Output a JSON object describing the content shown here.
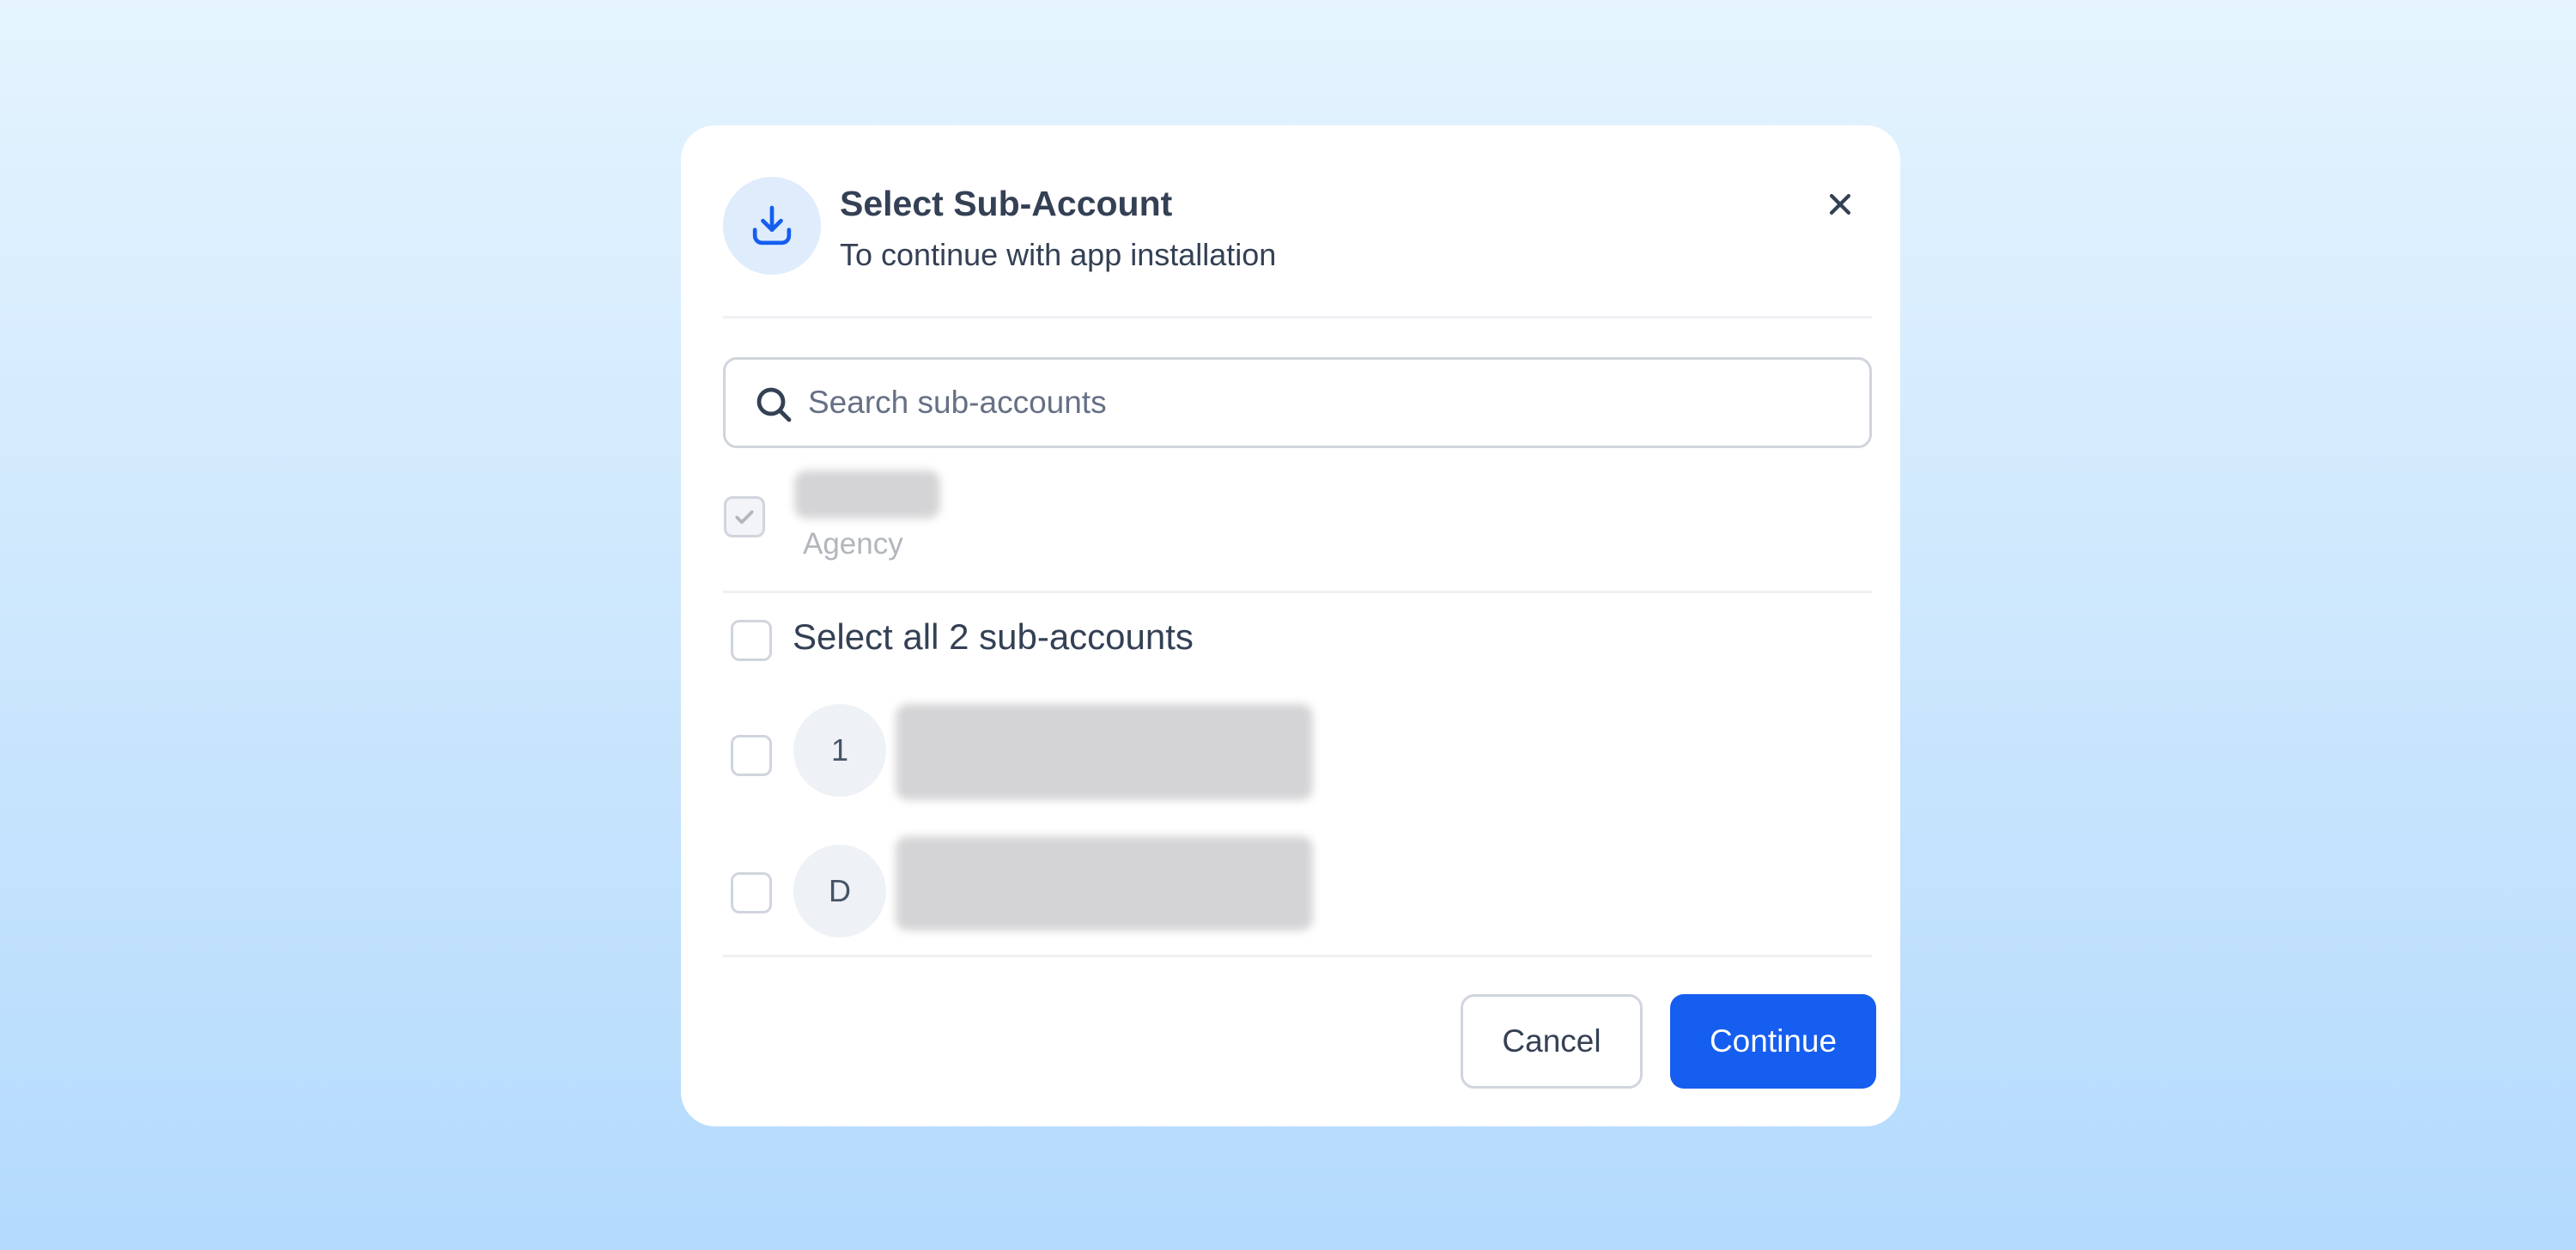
{
  "dialog": {
    "title": "Select Sub-Account",
    "subtitle": "To continue with app installation",
    "header_icon": "download-icon",
    "close_icon": "close-icon"
  },
  "search": {
    "placeholder": "Search sub-accounts",
    "value": "",
    "icon": "search-icon"
  },
  "agency": {
    "name": "",
    "label": "Agency",
    "checked": true,
    "disabled": true
  },
  "select_all": {
    "label": "Select all 2 sub-accounts",
    "checked": false
  },
  "sub_accounts": [
    {
      "avatar": "1",
      "name": "",
      "address": "",
      "checked": false
    },
    {
      "avatar": "D",
      "name": "",
      "address": "",
      "checked": false
    }
  ],
  "footer": {
    "cancel_label": "Cancel",
    "continue_label": "Continue"
  },
  "colors": {
    "primary": "#155eef",
    "text": "#344054",
    "muted": "#667085",
    "border": "#d0d5dd"
  }
}
